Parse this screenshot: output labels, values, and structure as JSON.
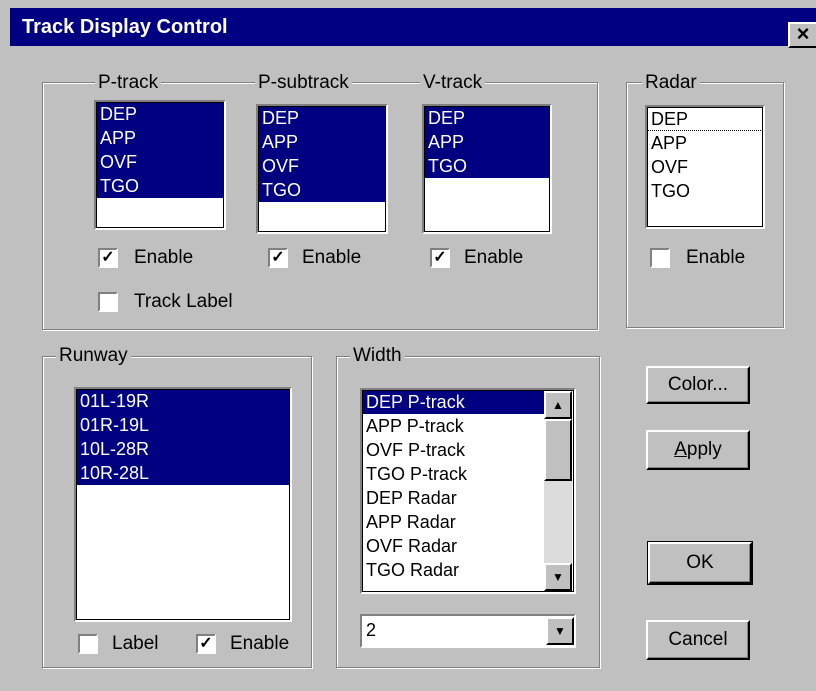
{
  "window": {
    "title": "Track Display Control",
    "close_glyph": "×"
  },
  "ptrack": {
    "label": "P-track",
    "items": [
      "DEP",
      "APP",
      "OVF",
      "TGO"
    ],
    "enable_label": "Enable",
    "enable_checked": true,
    "track_label": "Track Label",
    "track_label_checked": false
  },
  "psubtrack": {
    "label": "P-subtrack",
    "items": [
      "DEP",
      "APP",
      "OVF",
      "TGO"
    ],
    "enable_label": "Enable",
    "enable_checked": true
  },
  "vtrack": {
    "label": "V-track",
    "items": [
      "DEP",
      "APP",
      "TGO"
    ],
    "enable_label": "Enable",
    "enable_checked": true
  },
  "radar": {
    "label": "Radar",
    "items": [
      "DEP",
      "APP",
      "OVF",
      "TGO"
    ],
    "enable_label": "Enable",
    "enable_checked": false
  },
  "runway": {
    "label": "Runway",
    "items": [
      "01L-19R",
      "01R-19L",
      "10L-28R",
      "10R-28L"
    ],
    "label_checkbox": "Label",
    "label_checked": false,
    "enable_label": "Enable",
    "enable_checked": true
  },
  "width": {
    "label": "Width",
    "items": [
      "DEP P-track",
      "APP P-track",
      "OVF P-track",
      "TGO P-track",
      "DEP Radar",
      "APP Radar",
      "OVF Radar",
      "TGO Radar"
    ],
    "selected": "DEP P-track",
    "combo_value": "2"
  },
  "buttons": {
    "color": "Color...",
    "apply": "Apply",
    "ok": "OK",
    "cancel": "Cancel"
  },
  "check_glyph": "✓"
}
